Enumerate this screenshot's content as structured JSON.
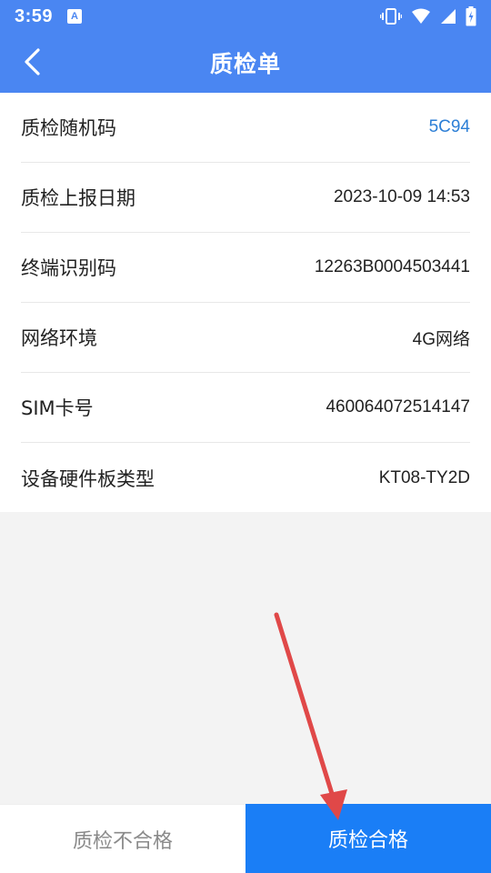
{
  "status_bar": {
    "time": "3:59",
    "notification_icon": "A",
    "icons": [
      "vibrate-icon",
      "wifi-icon",
      "signal-icon",
      "battery-icon"
    ]
  },
  "header": {
    "title": "质检单",
    "back_icon": "chevron-left-icon"
  },
  "rows": [
    {
      "label": "质检随机码",
      "value": "5C94"
    },
    {
      "label": "质检上报日期",
      "value": "2023-10-09 14:53"
    },
    {
      "label": "终端识别码",
      "value": "12263B0004503441"
    },
    {
      "label": "网络环境",
      "value": "4G网络"
    },
    {
      "label": "SIM卡号",
      "value": "460064072514147"
    },
    {
      "label": "设备硬件板类型",
      "value": "KT08-TY2D"
    }
  ],
  "actions": {
    "fail_label": "质检不合格",
    "pass_label": "质检合格"
  },
  "colors": {
    "header": "#4a86f2",
    "accent_value": "#2d7fd6",
    "primary_button": "#1a7ef6",
    "annotation_arrow": "#e04848"
  }
}
